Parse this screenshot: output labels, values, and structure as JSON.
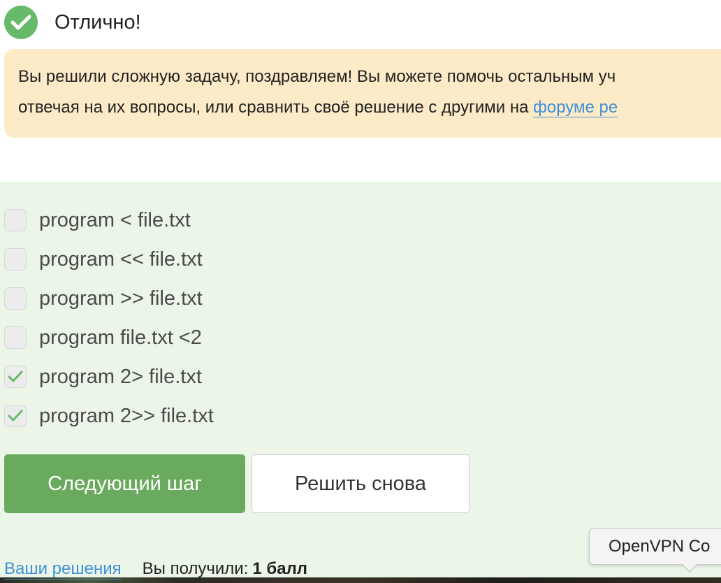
{
  "status": {
    "title": "Отлично!",
    "icon": "check-circle-icon",
    "color": "#66bb6a"
  },
  "notice": {
    "line1": "Вы решили сложную задачу, поздравляем! Вы можете помочь остальным уч",
    "line2_prefix": "отвечая на их вопросы, или сравнить своё решение с другими на ",
    "link_text": "форуме ре",
    "background": "#fdebc8"
  },
  "options": [
    {
      "label": "program < file.txt",
      "checked": false
    },
    {
      "label": "program << file.txt",
      "checked": false
    },
    {
      "label": "program >> file.txt",
      "checked": false
    },
    {
      "label": "program file.txt <2",
      "checked": false
    },
    {
      "label": "program 2> file.txt",
      "checked": true
    },
    {
      "label": "program 2>> file.txt",
      "checked": true
    }
  ],
  "buttons": {
    "next": "Следующий шаг",
    "retry": "Решить снова"
  },
  "tooltip": {
    "text": "OpenVPN Co"
  },
  "footer": {
    "solutions_link": "Ваши решения",
    "score_label": "Вы получили:",
    "score_value": "1 балл"
  }
}
